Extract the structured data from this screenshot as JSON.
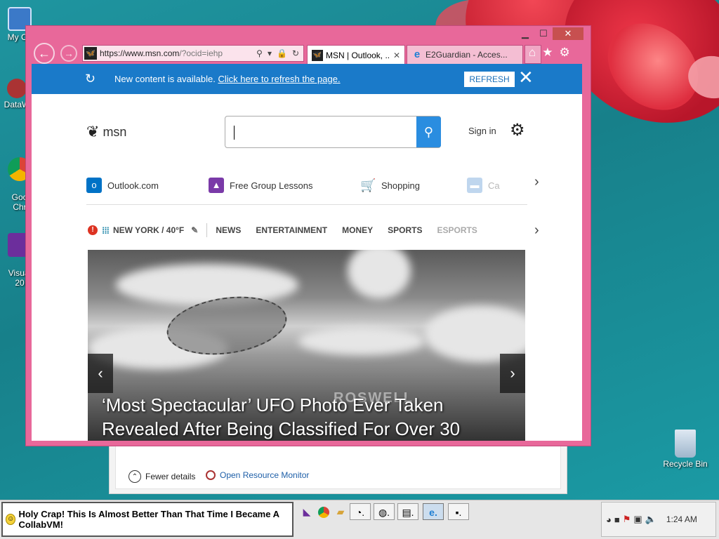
{
  "desktop": {
    "icons": [
      {
        "label": "My Co",
        "glyph": "💻"
      },
      {
        "label": "DataW",
        "glyph": "🗄"
      },
      {
        "label": "Goo\nChr",
        "glyph": "⬤"
      },
      {
        "label": "Visual\n20",
        "glyph": "▶"
      },
      {
        "label": "Recycle Bin",
        "glyph": "🗑"
      }
    ]
  },
  "back_window": {
    "fewer_details": "Fewer details",
    "open_resource_monitor": "Open Resource Monitor"
  },
  "browser": {
    "titlebar": {
      "minimize": "▁",
      "maximize": "☐",
      "close": "✕"
    },
    "address": {
      "url_main": "https://www.msn.com",
      "url_rest": "/?ocid=iehp"
    },
    "tabs": [
      {
        "title": "MSN | Outlook, ...",
        "active": true
      },
      {
        "title": "E2Guardian - Acces...",
        "active": false
      }
    ],
    "notification": {
      "message": "New content is available.",
      "link": "Click here to refresh the page.",
      "refresh_button": "REFRESH"
    },
    "msn": {
      "logo_text": "msn",
      "signin": "Sign in",
      "quick_links": [
        {
          "label": "Outlook.com",
          "icon": "outlook-icon",
          "color": "#0072c6"
        },
        {
          "label": "Free Group Lessons",
          "icon": "graduation-cap-icon",
          "color": "#7a3aa8"
        },
        {
          "label": "Shopping",
          "icon": "cart-icon",
          "color": "#1a6fd8"
        },
        {
          "label": "Ca",
          "icon": "car-icon",
          "color": "#4a8ccf"
        }
      ],
      "nav": {
        "weather": "NEW YORK / 40°F",
        "items": [
          "NEWS",
          "ENTERTAINMENT",
          "MONEY",
          "SPORTS",
          "ESPORTS"
        ]
      },
      "hero": {
        "title": "‘Most Spectacular’ UFO Photo Ever Taken Revealed After Being Classified For Over 30",
        "sign_text": "ROSWELL"
      }
    }
  },
  "taskbar": {
    "start_message": "Holy Crap! This Is Almost Better Than That Time I Became A CollabVM!",
    "clock": "1:24 AM"
  }
}
